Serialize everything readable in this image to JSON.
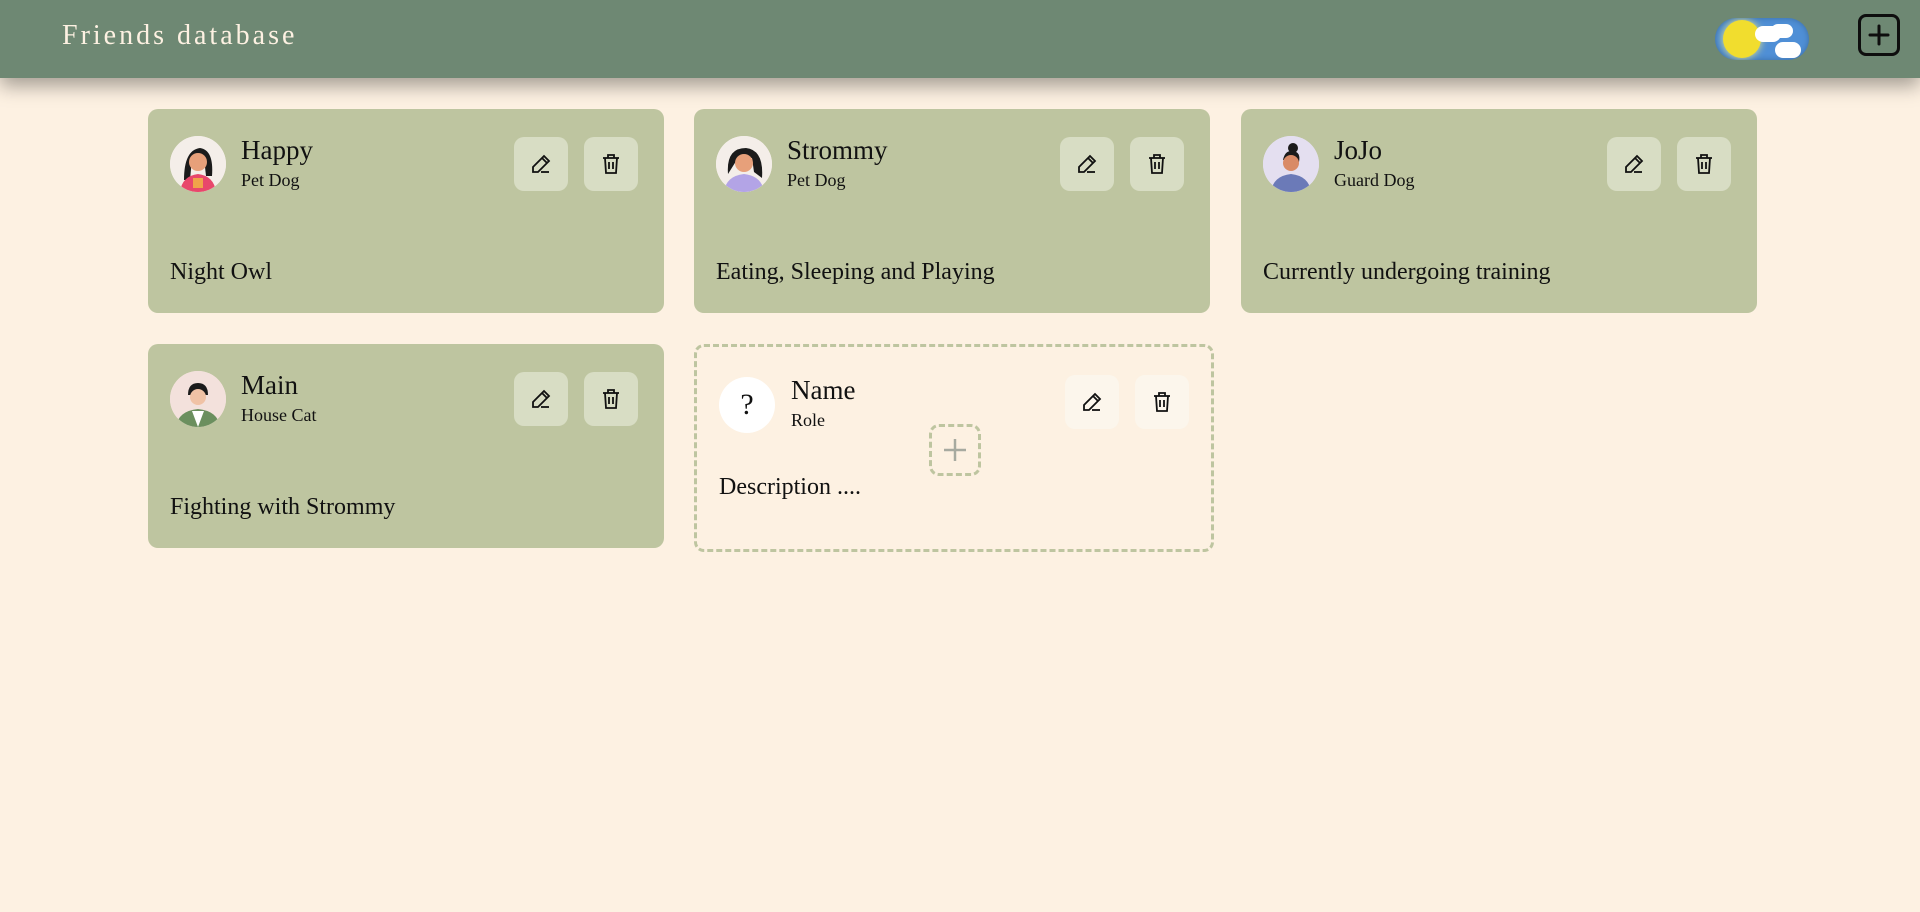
{
  "header": {
    "title": "Friends database",
    "theme_toggle_icon": "sun-cloud-toggle-icon",
    "add_icon": "plus-square-icon"
  },
  "colors": {
    "background": "#fdf1e2",
    "header": "#6e8873",
    "card": "#bec5a0",
    "button": "#d8ddc4"
  },
  "cards": [
    {
      "name": "Happy",
      "role": "Pet Dog",
      "description": "Night Owl"
    },
    {
      "name": "Strommy",
      "role": "Pet Dog",
      "description": "Eating, Sleeping and Playing"
    },
    {
      "name": "JoJo",
      "role": "Guard Dog",
      "description": "Currently undergoing training"
    },
    {
      "name": "Main",
      "role": "House Cat",
      "description": "Fighting with Strommy"
    }
  ],
  "placeholder": {
    "avatar_text": "?",
    "name": "Name",
    "role": "Role",
    "description": "Description ...."
  }
}
